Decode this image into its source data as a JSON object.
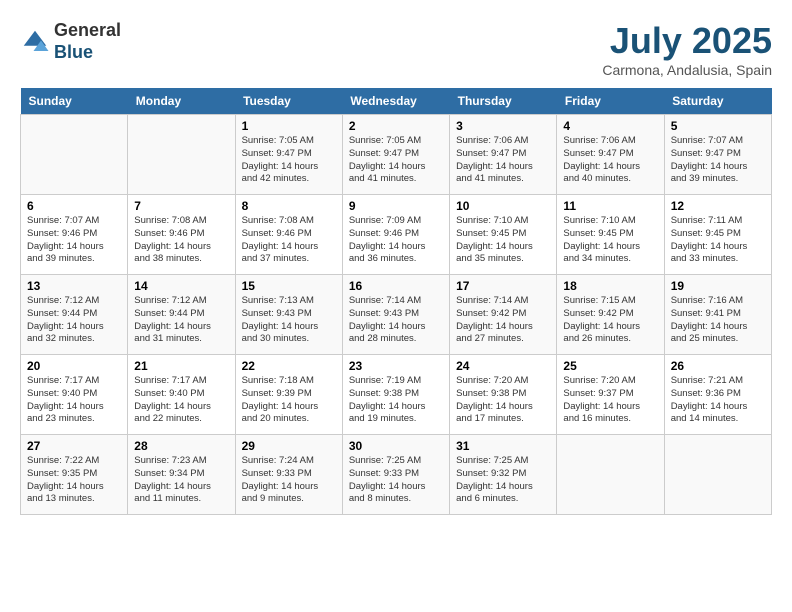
{
  "logo": {
    "general": "General",
    "blue": "Blue"
  },
  "title": {
    "month_year": "July 2025",
    "location": "Carmona, Andalusia, Spain"
  },
  "header_days": [
    "Sunday",
    "Monday",
    "Tuesday",
    "Wednesday",
    "Thursday",
    "Friday",
    "Saturday"
  ],
  "weeks": [
    [
      {
        "day": "",
        "content": ""
      },
      {
        "day": "",
        "content": ""
      },
      {
        "day": "1",
        "content": "Sunrise: 7:05 AM\nSunset: 9:47 PM\nDaylight: 14 hours and 42 minutes."
      },
      {
        "day": "2",
        "content": "Sunrise: 7:05 AM\nSunset: 9:47 PM\nDaylight: 14 hours and 41 minutes."
      },
      {
        "day": "3",
        "content": "Sunrise: 7:06 AM\nSunset: 9:47 PM\nDaylight: 14 hours and 41 minutes."
      },
      {
        "day": "4",
        "content": "Sunrise: 7:06 AM\nSunset: 9:47 PM\nDaylight: 14 hours and 40 minutes."
      },
      {
        "day": "5",
        "content": "Sunrise: 7:07 AM\nSunset: 9:47 PM\nDaylight: 14 hours and 39 minutes."
      }
    ],
    [
      {
        "day": "6",
        "content": "Sunrise: 7:07 AM\nSunset: 9:46 PM\nDaylight: 14 hours and 39 minutes."
      },
      {
        "day": "7",
        "content": "Sunrise: 7:08 AM\nSunset: 9:46 PM\nDaylight: 14 hours and 38 minutes."
      },
      {
        "day": "8",
        "content": "Sunrise: 7:08 AM\nSunset: 9:46 PM\nDaylight: 14 hours and 37 minutes."
      },
      {
        "day": "9",
        "content": "Sunrise: 7:09 AM\nSunset: 9:46 PM\nDaylight: 14 hours and 36 minutes."
      },
      {
        "day": "10",
        "content": "Sunrise: 7:10 AM\nSunset: 9:45 PM\nDaylight: 14 hours and 35 minutes."
      },
      {
        "day": "11",
        "content": "Sunrise: 7:10 AM\nSunset: 9:45 PM\nDaylight: 14 hours and 34 minutes."
      },
      {
        "day": "12",
        "content": "Sunrise: 7:11 AM\nSunset: 9:45 PM\nDaylight: 14 hours and 33 minutes."
      }
    ],
    [
      {
        "day": "13",
        "content": "Sunrise: 7:12 AM\nSunset: 9:44 PM\nDaylight: 14 hours and 32 minutes."
      },
      {
        "day": "14",
        "content": "Sunrise: 7:12 AM\nSunset: 9:44 PM\nDaylight: 14 hours and 31 minutes."
      },
      {
        "day": "15",
        "content": "Sunrise: 7:13 AM\nSunset: 9:43 PM\nDaylight: 14 hours and 30 minutes."
      },
      {
        "day": "16",
        "content": "Sunrise: 7:14 AM\nSunset: 9:43 PM\nDaylight: 14 hours and 28 minutes."
      },
      {
        "day": "17",
        "content": "Sunrise: 7:14 AM\nSunset: 9:42 PM\nDaylight: 14 hours and 27 minutes."
      },
      {
        "day": "18",
        "content": "Sunrise: 7:15 AM\nSunset: 9:42 PM\nDaylight: 14 hours and 26 minutes."
      },
      {
        "day": "19",
        "content": "Sunrise: 7:16 AM\nSunset: 9:41 PM\nDaylight: 14 hours and 25 minutes."
      }
    ],
    [
      {
        "day": "20",
        "content": "Sunrise: 7:17 AM\nSunset: 9:40 PM\nDaylight: 14 hours and 23 minutes."
      },
      {
        "day": "21",
        "content": "Sunrise: 7:17 AM\nSunset: 9:40 PM\nDaylight: 14 hours and 22 minutes."
      },
      {
        "day": "22",
        "content": "Sunrise: 7:18 AM\nSunset: 9:39 PM\nDaylight: 14 hours and 20 minutes."
      },
      {
        "day": "23",
        "content": "Sunrise: 7:19 AM\nSunset: 9:38 PM\nDaylight: 14 hours and 19 minutes."
      },
      {
        "day": "24",
        "content": "Sunrise: 7:20 AM\nSunset: 9:38 PM\nDaylight: 14 hours and 17 minutes."
      },
      {
        "day": "25",
        "content": "Sunrise: 7:20 AM\nSunset: 9:37 PM\nDaylight: 14 hours and 16 minutes."
      },
      {
        "day": "26",
        "content": "Sunrise: 7:21 AM\nSunset: 9:36 PM\nDaylight: 14 hours and 14 minutes."
      }
    ],
    [
      {
        "day": "27",
        "content": "Sunrise: 7:22 AM\nSunset: 9:35 PM\nDaylight: 14 hours and 13 minutes."
      },
      {
        "day": "28",
        "content": "Sunrise: 7:23 AM\nSunset: 9:34 PM\nDaylight: 14 hours and 11 minutes."
      },
      {
        "day": "29",
        "content": "Sunrise: 7:24 AM\nSunset: 9:33 PM\nDaylight: 14 hours and 9 minutes."
      },
      {
        "day": "30",
        "content": "Sunrise: 7:25 AM\nSunset: 9:33 PM\nDaylight: 14 hours and 8 minutes."
      },
      {
        "day": "31",
        "content": "Sunrise: 7:25 AM\nSunset: 9:32 PM\nDaylight: 14 hours and 6 minutes."
      },
      {
        "day": "",
        "content": ""
      },
      {
        "day": "",
        "content": ""
      }
    ]
  ]
}
